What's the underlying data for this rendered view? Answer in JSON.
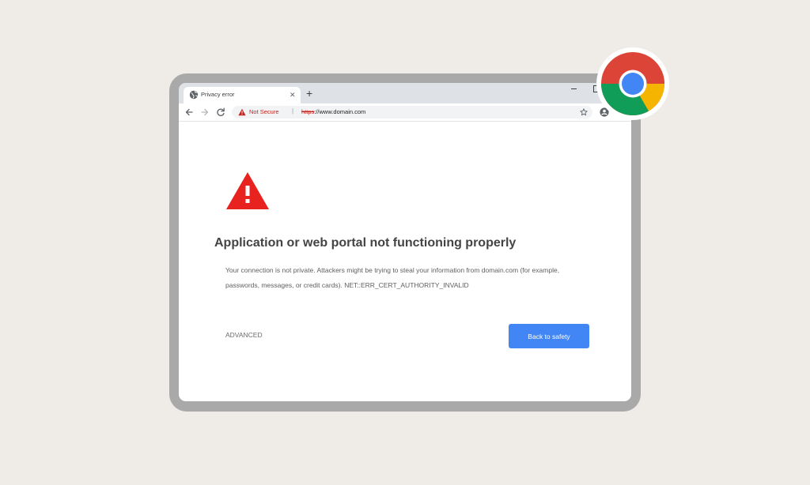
{
  "browser": {
    "tab": {
      "title": "Privacy error",
      "close_glyph": "✕",
      "favicon": "globe-icon"
    },
    "new_tab_glyph": "+",
    "toolbar": {
      "back_icon": "back-arrow-icon",
      "forward_icon": "forward-arrow-icon",
      "reload_icon": "reload-icon",
      "security_label": "Not Secure",
      "separator": "|",
      "url_scheme": "https",
      "url_rest": "://www.domain.com",
      "bookmark_icon": "star-icon",
      "profile_icon": "account-circle-icon"
    }
  },
  "page": {
    "warning_icon": "warning-triangle-icon",
    "heading": "Application or web portal not functioning properly",
    "message": "Your connection is not private. Attackers might be trying to steal your information from domain.com (for example, passwords, messages, or credit cards). NET::ERR_CERT_AUTHORITY_INVALID",
    "advanced_label": "ADVANCED",
    "safety_button_label": "Back to safety"
  },
  "colors": {
    "background": "#efece8",
    "frame": "#a9a9a9",
    "warning_red": "#e8231f",
    "button_blue": "#4285f4",
    "not_secure_red": "#c5221f"
  },
  "logo": "chrome-logo"
}
